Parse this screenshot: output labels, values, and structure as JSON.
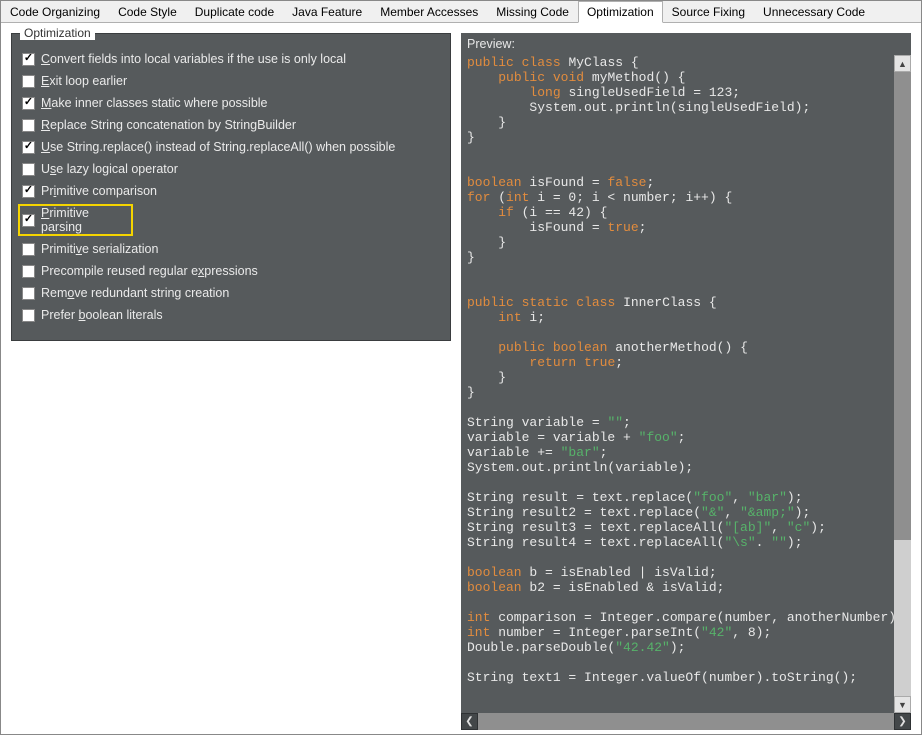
{
  "tabs": [
    {
      "label": "Code Organizing",
      "active": false
    },
    {
      "label": "Code Style",
      "active": false
    },
    {
      "label": "Duplicate code",
      "active": false
    },
    {
      "label": "Java Feature",
      "active": false
    },
    {
      "label": "Member Accesses",
      "active": false
    },
    {
      "label": "Missing Code",
      "active": false
    },
    {
      "label": "Optimization",
      "active": true
    },
    {
      "label": "Source Fixing",
      "active": false
    },
    {
      "label": "Unnecessary Code",
      "active": false
    }
  ],
  "left": {
    "group_label": "Optimization",
    "items": [
      {
        "checked": true,
        "text": "Convert fields into local variables if the use is only local",
        "mnemonic": "C",
        "highlight": false
      },
      {
        "checked": false,
        "text": "Exit loop earlier",
        "mnemonic": "E",
        "highlight": false
      },
      {
        "checked": true,
        "text": "Make inner classes static where possible",
        "mnemonic": "M",
        "highlight": false
      },
      {
        "checked": false,
        "text": "Replace String concatenation by StringBuilder",
        "mnemonic": "R",
        "highlight": false
      },
      {
        "checked": true,
        "text": "Use String.replace() instead of String.replaceAll() when possible",
        "mnemonic": "U",
        "highlight": false
      },
      {
        "checked": false,
        "text": "Use lazy logical operator",
        "mnemonic": "s",
        "highlight": false
      },
      {
        "checked": true,
        "text": "Primitive comparison",
        "mnemonic": "i",
        "highlight": false
      },
      {
        "checked": true,
        "text": "Primitive parsing",
        "mnemonic": "P",
        "highlight": true
      },
      {
        "checked": false,
        "text": "Primitive serialization",
        "mnemonic": "v",
        "highlight": false
      },
      {
        "checked": false,
        "text": "Precompile reused regular expressions",
        "mnemonic": "x",
        "highlight": false
      },
      {
        "checked": false,
        "text": "Remove redundant string creation",
        "mnemonic": "o",
        "highlight": false
      },
      {
        "checked": false,
        "text": "Prefer boolean literals",
        "mnemonic": "b",
        "highlight": false
      }
    ]
  },
  "right": {
    "preview_label": "Preview:",
    "code_tokens": [
      [
        {
          "t": "public",
          "c": "kw"
        },
        {
          "t": " "
        },
        {
          "t": "class",
          "c": "kw"
        },
        {
          "t": " MyClass {"
        }
      ],
      [
        {
          "t": "    "
        },
        {
          "t": "public",
          "c": "kw"
        },
        {
          "t": " "
        },
        {
          "t": "void",
          "c": "kw"
        },
        {
          "t": " myMethod() {"
        }
      ],
      [
        {
          "t": "        "
        },
        {
          "t": "long",
          "c": "kw"
        },
        {
          "t": " singleUsedField = 123;"
        }
      ],
      [
        {
          "t": "        System.out.println(singleUsedField);"
        }
      ],
      [
        {
          "t": "    }"
        }
      ],
      [
        {
          "t": "}"
        }
      ],
      [],
      [],
      [
        {
          "t": "boolean",
          "c": "kw"
        },
        {
          "t": " isFound = "
        },
        {
          "t": "false",
          "c": "kw"
        },
        {
          "t": ";"
        }
      ],
      [
        {
          "t": "for",
          "c": "kw"
        },
        {
          "t": " ("
        },
        {
          "t": "int",
          "c": "kw"
        },
        {
          "t": " i = 0; i < number; i++) {"
        }
      ],
      [
        {
          "t": "    "
        },
        {
          "t": "if",
          "c": "kw"
        },
        {
          "t": " (i == 42) {"
        }
      ],
      [
        {
          "t": "        isFound = "
        },
        {
          "t": "true",
          "c": "kw"
        },
        {
          "t": ";"
        }
      ],
      [
        {
          "t": "    }"
        }
      ],
      [
        {
          "t": "}"
        }
      ],
      [],
      [],
      [
        {
          "t": "public",
          "c": "kw"
        },
        {
          "t": " "
        },
        {
          "t": "static",
          "c": "kw"
        },
        {
          "t": " "
        },
        {
          "t": "class",
          "c": "kw"
        },
        {
          "t": " InnerClass {"
        }
      ],
      [
        {
          "t": "    "
        },
        {
          "t": "int",
          "c": "kw"
        },
        {
          "t": " i;"
        }
      ],
      [],
      [
        {
          "t": "    "
        },
        {
          "t": "public",
          "c": "kw"
        },
        {
          "t": " "
        },
        {
          "t": "boolean",
          "c": "kw"
        },
        {
          "t": " anotherMethod() {"
        }
      ],
      [
        {
          "t": "        "
        },
        {
          "t": "return",
          "c": "kw"
        },
        {
          "t": " "
        },
        {
          "t": "true",
          "c": "kw"
        },
        {
          "t": ";"
        }
      ],
      [
        {
          "t": "    }"
        }
      ],
      [
        {
          "t": "}"
        }
      ],
      [],
      [
        {
          "t": "String variable = "
        },
        {
          "t": "\"\"",
          "c": "str"
        },
        {
          "t": ";"
        }
      ],
      [
        {
          "t": "variable = variable + "
        },
        {
          "t": "\"foo\"",
          "c": "str"
        },
        {
          "t": ";"
        }
      ],
      [
        {
          "t": "variable += "
        },
        {
          "t": "\"bar\"",
          "c": "str"
        },
        {
          "t": ";"
        }
      ],
      [
        {
          "t": "System.out.println(variable);"
        }
      ],
      [],
      [
        {
          "t": "String result = text.replace("
        },
        {
          "t": "\"foo\"",
          "c": "str"
        },
        {
          "t": ", "
        },
        {
          "t": "\"bar\"",
          "c": "str"
        },
        {
          "t": ");"
        }
      ],
      [
        {
          "t": "String result2 = text.replace("
        },
        {
          "t": "\"&\"",
          "c": "str"
        },
        {
          "t": ", "
        },
        {
          "t": "\"&amp;\"",
          "c": "str"
        },
        {
          "t": ");"
        }
      ],
      [
        {
          "t": "String result3 = text.replaceAll("
        },
        {
          "t": "\"[ab]\"",
          "c": "str"
        },
        {
          "t": ", "
        },
        {
          "t": "\"c\"",
          "c": "str"
        },
        {
          "t": ");"
        }
      ],
      [
        {
          "t": "String result4 = text.replaceAll("
        },
        {
          "t": "\"\\s\"",
          "c": "str"
        },
        {
          "t": ". "
        },
        {
          "t": "\"\"",
          "c": "str"
        },
        {
          "t": ");"
        }
      ],
      [],
      [
        {
          "t": "boolean",
          "c": "kw"
        },
        {
          "t": " b = isEnabled | isValid;"
        }
      ],
      [
        {
          "t": "boolean",
          "c": "kw"
        },
        {
          "t": " b2 = isEnabled & isValid;"
        }
      ],
      [],
      [
        {
          "t": "int",
          "c": "kw"
        },
        {
          "t": " comparison = Integer.compare(number, anotherNumber);"
        }
      ],
      [
        {
          "t": "int",
          "c": "kw"
        },
        {
          "t": " number = Integer.parseInt("
        },
        {
          "t": "\"42\"",
          "c": "str"
        },
        {
          "t": ", 8);"
        }
      ],
      [
        {
          "t": "Double.parseDouble("
        },
        {
          "t": "\"42.42\"",
          "c": "str"
        },
        {
          "t": ");"
        }
      ],
      [],
      [
        {
          "t": "String text1 = Integer.valueOf(number).toString();"
        }
      ]
    ]
  }
}
